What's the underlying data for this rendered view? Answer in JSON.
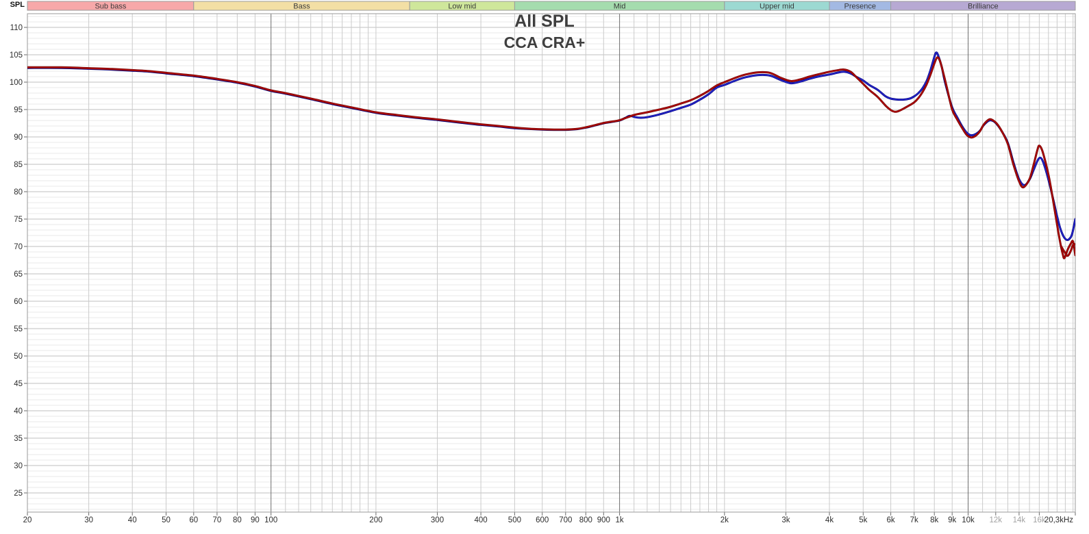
{
  "chart_data": {
    "type": "line",
    "title": "All SPL",
    "subtitle": "CCA CRA+",
    "x_axis": {
      "scale": "log",
      "unit": "Hz",
      "min": 20,
      "max": 20300,
      "major_gridlines": [
        100,
        1000,
        10000
      ],
      "ticks": [
        {
          "f": 20,
          "label": "20"
        },
        {
          "f": 30,
          "label": "30"
        },
        {
          "f": 40,
          "label": "40"
        },
        {
          "f": 50,
          "label": "50"
        },
        {
          "f": 60,
          "label": "60"
        },
        {
          "f": 70,
          "label": "70"
        },
        {
          "f": 80,
          "label": "80"
        },
        {
          "f": 90,
          "label": "90"
        },
        {
          "f": 100,
          "label": "100"
        },
        {
          "f": 200,
          "label": "200"
        },
        {
          "f": 300,
          "label": "300"
        },
        {
          "f": 400,
          "label": "400"
        },
        {
          "f": 500,
          "label": "500"
        },
        {
          "f": 600,
          "label": "600"
        },
        {
          "f": 700,
          "label": "700"
        },
        {
          "f": 800,
          "label": "800"
        },
        {
          "f": 900,
          "label": "900"
        },
        {
          "f": 1000,
          "label": "1k"
        },
        {
          "f": 2000,
          "label": "2k"
        },
        {
          "f": 3000,
          "label": "3k"
        },
        {
          "f": 4000,
          "label": "4k"
        },
        {
          "f": 5000,
          "label": "5k"
        },
        {
          "f": 6000,
          "label": "6k"
        },
        {
          "f": 7000,
          "label": "7k"
        },
        {
          "f": 8000,
          "label": "8k"
        },
        {
          "f": 9000,
          "label": "9k"
        },
        {
          "f": 10000,
          "label": "10k"
        },
        {
          "f": 12000,
          "label": "12k",
          "muted": true
        },
        {
          "f": 14000,
          "label": "14k",
          "muted": true
        },
        {
          "f": 16000,
          "label": "16k",
          "muted": true
        },
        {
          "f": 20300,
          "label": "20,3kHz",
          "anchor": "end"
        }
      ]
    },
    "y_axis": {
      "label": "SPL",
      "min": 21.5,
      "max": 112.5,
      "tick_step": 5,
      "minor_step": 1,
      "tick_labels": [
        110,
        105,
        100,
        95,
        90,
        85,
        80,
        75,
        70,
        65,
        60,
        55,
        50,
        45,
        40,
        35,
        30,
        25
      ]
    },
    "bands": [
      {
        "label": "Sub bass",
        "f_start": 20,
        "f_end": 60,
        "color": "#f7a8a9"
      },
      {
        "label": "Bass",
        "f_start": 60,
        "f_end": 250,
        "color": "#f3dfa5"
      },
      {
        "label": "Low mid",
        "f_start": 250,
        "f_end": 500,
        "color": "#cfe79b"
      },
      {
        "label": "Mid",
        "f_start": 500,
        "f_end": 2000,
        "color": "#a5dcae"
      },
      {
        "label": "Upper mid",
        "f_start": 2000,
        "f_end": 4000,
        "color": "#9cd9d2"
      },
      {
        "label": "Presence",
        "f_start": 4000,
        "f_end": 6000,
        "color": "#a3b9e3"
      },
      {
        "label": "Brilliance",
        "f_start": 6000,
        "f_end": 20300,
        "color": "#b7a9d3"
      }
    ],
    "colors": {
      "grid_minor_h": "#e8e8e8",
      "grid_major_h": "#bfbfbf",
      "grid_minor_v": "#cbcbcb",
      "grid_major_v": "#6e6e6e",
      "plot_border": "#9a9a9a",
      "tick": "#6a6a6a",
      "tick_label": "#2d2d2d",
      "tick_label_muted": "#a2a2a2",
      "band_border": "#9b9b9b",
      "band_text": "#3a3a3a"
    },
    "series": [
      {
        "name": "trace-blue",
        "color": "#2525c8",
        "edge": "#000082",
        "points": [
          [
            20,
            102.6
          ],
          [
            25,
            102.6
          ],
          [
            30,
            102.45
          ],
          [
            35,
            102.3
          ],
          [
            40,
            102.1
          ],
          [
            45,
            101.9
          ],
          [
            50,
            101.6
          ],
          [
            60,
            101.1
          ],
          [
            70,
            100.5
          ],
          [
            80,
            99.9
          ],
          [
            90,
            99.2
          ],
          [
            100,
            98.4
          ],
          [
            110,
            97.9
          ],
          [
            130,
            96.9
          ],
          [
            150,
            96.0
          ],
          [
            170,
            95.3
          ],
          [
            200,
            94.4
          ],
          [
            230,
            93.9
          ],
          [
            260,
            93.5
          ],
          [
            300,
            93.1
          ],
          [
            350,
            92.6
          ],
          [
            400,
            92.2
          ],
          [
            450,
            91.9
          ],
          [
            500,
            91.6
          ],
          [
            550,
            91.45
          ],
          [
            600,
            91.35
          ],
          [
            650,
            91.3
          ],
          [
            700,
            91.3
          ],
          [
            750,
            91.4
          ],
          [
            800,
            91.7
          ],
          [
            850,
            92.1
          ],
          [
            900,
            92.5
          ],
          [
            950,
            92.75
          ],
          [
            1000,
            93.0
          ],
          [
            1040,
            93.5
          ],
          [
            1070,
            93.85
          ],
          [
            1110,
            93.6
          ],
          [
            1150,
            93.5
          ],
          [
            1200,
            93.6
          ],
          [
            1300,
            94.1
          ],
          [
            1400,
            94.7
          ],
          [
            1500,
            95.3
          ],
          [
            1600,
            95.9
          ],
          [
            1700,
            96.8
          ],
          [
            1800,
            97.8
          ],
          [
            1900,
            99.0
          ],
          [
            2000,
            99.5
          ],
          [
            2150,
            100.3
          ],
          [
            2300,
            100.9
          ],
          [
            2500,
            101.3
          ],
          [
            2700,
            101.2
          ],
          [
            2900,
            100.4
          ],
          [
            3100,
            99.8
          ],
          [
            3300,
            100.1
          ],
          [
            3500,
            100.6
          ],
          [
            3700,
            101.0
          ],
          [
            4000,
            101.4
          ],
          [
            4200,
            101.7
          ],
          [
            4400,
            101.9
          ],
          [
            4600,
            101.6
          ],
          [
            4800,
            100.9
          ],
          [
            5000,
            100.3
          ],
          [
            5200,
            99.5
          ],
          [
            5500,
            98.6
          ],
          [
            5800,
            97.4
          ],
          [
            6000,
            97.0
          ],
          [
            6200,
            96.85
          ],
          [
            6500,
            96.8
          ],
          [
            6800,
            97.0
          ],
          [
            7000,
            97.4
          ],
          [
            7200,
            98.0
          ],
          [
            7400,
            98.9
          ],
          [
            7600,
            100.2
          ],
          [
            7800,
            102.2
          ],
          [
            8000,
            104.6
          ],
          [
            8100,
            105.4
          ],
          [
            8200,
            104.9
          ],
          [
            8400,
            102.8
          ],
          [
            8600,
            99.8
          ],
          [
            9000,
            95.4
          ],
          [
            9300,
            93.6
          ],
          [
            9600,
            92.0
          ],
          [
            9900,
            90.8
          ],
          [
            10200,
            90.3
          ],
          [
            10500,
            90.5
          ],
          [
            10800,
            91.1
          ],
          [
            11100,
            92.2
          ],
          [
            11500,
            93.0
          ],
          [
            11800,
            92.9
          ],
          [
            12100,
            92.3
          ],
          [
            12500,
            91.0
          ],
          [
            13000,
            88.9
          ],
          [
            13500,
            85.3
          ],
          [
            14000,
            82.3
          ],
          [
            14500,
            81.2
          ],
          [
            15000,
            82.2
          ],
          [
            15400,
            83.9
          ],
          [
            15800,
            85.6
          ],
          [
            16100,
            86.2
          ],
          [
            16400,
            85.5
          ],
          [
            16800,
            83.4
          ],
          [
            17200,
            80.9
          ],
          [
            17600,
            78.2
          ],
          [
            18000,
            75.5
          ],
          [
            18400,
            73.2
          ],
          [
            18800,
            71.8
          ],
          [
            19200,
            71.2
          ],
          [
            19600,
            71.5
          ],
          [
            19900,
            72.4
          ],
          [
            20300,
            75.0
          ]
        ]
      },
      {
        "name": "trace-red",
        "color": "#ad0a0a",
        "edge": "#700000",
        "points": [
          [
            20,
            102.7
          ],
          [
            25,
            102.7
          ],
          [
            30,
            102.55
          ],
          [
            35,
            102.4
          ],
          [
            40,
            102.2
          ],
          [
            45,
            102.0
          ],
          [
            50,
            101.7
          ],
          [
            60,
            101.2
          ],
          [
            70,
            100.6
          ],
          [
            80,
            100.0
          ],
          [
            90,
            99.3
          ],
          [
            100,
            98.5
          ],
          [
            110,
            98.0
          ],
          [
            130,
            97.0
          ],
          [
            150,
            96.1
          ],
          [
            170,
            95.4
          ],
          [
            200,
            94.5
          ],
          [
            230,
            94.0
          ],
          [
            260,
            93.6
          ],
          [
            300,
            93.2
          ],
          [
            350,
            92.7
          ],
          [
            400,
            92.3
          ],
          [
            450,
            92.0
          ],
          [
            500,
            91.7
          ],
          [
            550,
            91.5
          ],
          [
            600,
            91.4
          ],
          [
            650,
            91.35
          ],
          [
            700,
            91.35
          ],
          [
            750,
            91.45
          ],
          [
            800,
            91.75
          ],
          [
            850,
            92.15
          ],
          [
            900,
            92.55
          ],
          [
            950,
            92.8
          ],
          [
            1000,
            93.05
          ],
          [
            1100,
            94.0
          ],
          [
            1200,
            94.5
          ],
          [
            1300,
            95.0
          ],
          [
            1400,
            95.5
          ],
          [
            1500,
            96.1
          ],
          [
            1600,
            96.7
          ],
          [
            1700,
            97.5
          ],
          [
            1800,
            98.4
          ],
          [
            1900,
            99.4
          ],
          [
            2000,
            100.0
          ],
          [
            2150,
            100.8
          ],
          [
            2300,
            101.4
          ],
          [
            2500,
            101.8
          ],
          [
            2700,
            101.7
          ],
          [
            2900,
            100.8
          ],
          [
            3100,
            100.2
          ],
          [
            3300,
            100.5
          ],
          [
            3500,
            101.0
          ],
          [
            3700,
            101.4
          ],
          [
            4000,
            101.9
          ],
          [
            4200,
            102.15
          ],
          [
            4400,
            102.3
          ],
          [
            4600,
            101.9
          ],
          [
            4800,
            100.8
          ],
          [
            5000,
            99.7
          ],
          [
            5200,
            98.6
          ],
          [
            5500,
            97.3
          ],
          [
            5800,
            95.7
          ],
          [
            6000,
            94.9
          ],
          [
            6150,
            94.6
          ],
          [
            6300,
            94.7
          ],
          [
            6500,
            95.1
          ],
          [
            6800,
            95.8
          ],
          [
            7000,
            96.3
          ],
          [
            7200,
            97.1
          ],
          [
            7400,
            98.2
          ],
          [
            7600,
            99.6
          ],
          [
            7800,
            101.4
          ],
          [
            8000,
            103.4
          ],
          [
            8150,
            104.5
          ],
          [
            8300,
            103.9
          ],
          [
            8500,
            101.5
          ],
          [
            8700,
            98.9
          ],
          [
            9000,
            95.0
          ],
          [
            9300,
            93.2
          ],
          [
            9600,
            91.7
          ],
          [
            9900,
            90.4
          ],
          [
            10200,
            89.9
          ],
          [
            10500,
            90.2
          ],
          [
            10800,
            91.0
          ],
          [
            11100,
            92.3
          ],
          [
            11500,
            93.2
          ],
          [
            11800,
            93.0
          ],
          [
            12100,
            92.4
          ],
          [
            12500,
            91.0
          ],
          [
            13000,
            88.7
          ],
          [
            13500,
            84.9
          ],
          [
            14000,
            81.9
          ],
          [
            14400,
            80.8
          ],
          [
            15000,
            82.3
          ],
          [
            15400,
            84.8
          ],
          [
            15800,
            87.6
          ],
          [
            16000,
            88.4
          ],
          [
            16300,
            87.6
          ],
          [
            16700,
            85.2
          ],
          [
            17100,
            82.3
          ],
          [
            17500,
            78.7
          ],
          [
            17900,
            74.9
          ],
          [
            18300,
            71.3
          ],
          [
            18700,
            68.5
          ],
          [
            18900,
            67.9
          ],
          [
            19300,
            69.4
          ],
          [
            19700,
            70.5
          ],
          [
            20000,
            70.9
          ],
          [
            20300,
            68.4
          ]
        ]
      },
      {
        "name": "trace-red-tail",
        "color": "#ad0a0a",
        "edge": "#700000",
        "points": [
          [
            18500,
            70.0
          ],
          [
            18900,
            69.0
          ],
          [
            19300,
            68.3
          ],
          [
            19700,
            69.2
          ],
          [
            20000,
            70.3
          ],
          [
            20300,
            70.4
          ]
        ]
      }
    ]
  }
}
